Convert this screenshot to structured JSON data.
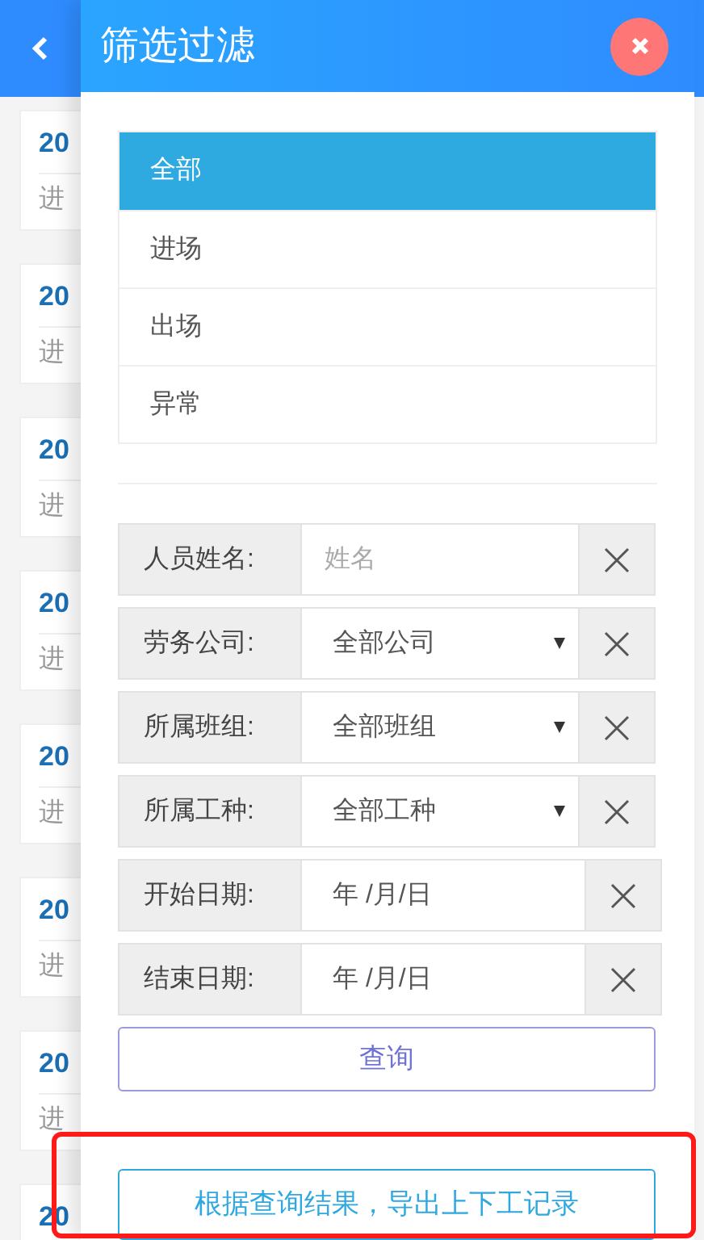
{
  "back_page": {
    "records": [
      {
        "date": "20",
        "status": "进"
      },
      {
        "date": "20",
        "status": "进"
      },
      {
        "date": "20",
        "status": "进"
      },
      {
        "date": "20",
        "status": "进"
      },
      {
        "date": "20",
        "status": "进"
      },
      {
        "date": "20",
        "status": "进"
      },
      {
        "date": "20",
        "status": "进"
      },
      {
        "date": "20"
      }
    ]
  },
  "filter_panel": {
    "title": "筛选过滤",
    "status_options": [
      {
        "label": "全部",
        "selected": true
      },
      {
        "label": "进场",
        "selected": false
      },
      {
        "label": "出场",
        "selected": false
      },
      {
        "label": "异常",
        "selected": false
      }
    ],
    "fields": [
      {
        "kind": "text",
        "label": "人员姓名:",
        "placeholder": "姓名"
      },
      {
        "kind": "select",
        "label": "劳务公司:",
        "value": "全部公司"
      },
      {
        "kind": "select",
        "label": "所属班组:",
        "value": "全部班组"
      },
      {
        "kind": "select",
        "label": "所属工种:",
        "value": "全部工种"
      },
      {
        "kind": "date",
        "label": "开始日期:",
        "value": "年 /月/日"
      },
      {
        "kind": "date",
        "label": "结束日期:",
        "value": "年 /月/日"
      }
    ],
    "query_button": {
      "label": "查询"
    },
    "export_button": {
      "label": "根据查询结果，导出上下工记录",
      "highlighted": true
    }
  }
}
